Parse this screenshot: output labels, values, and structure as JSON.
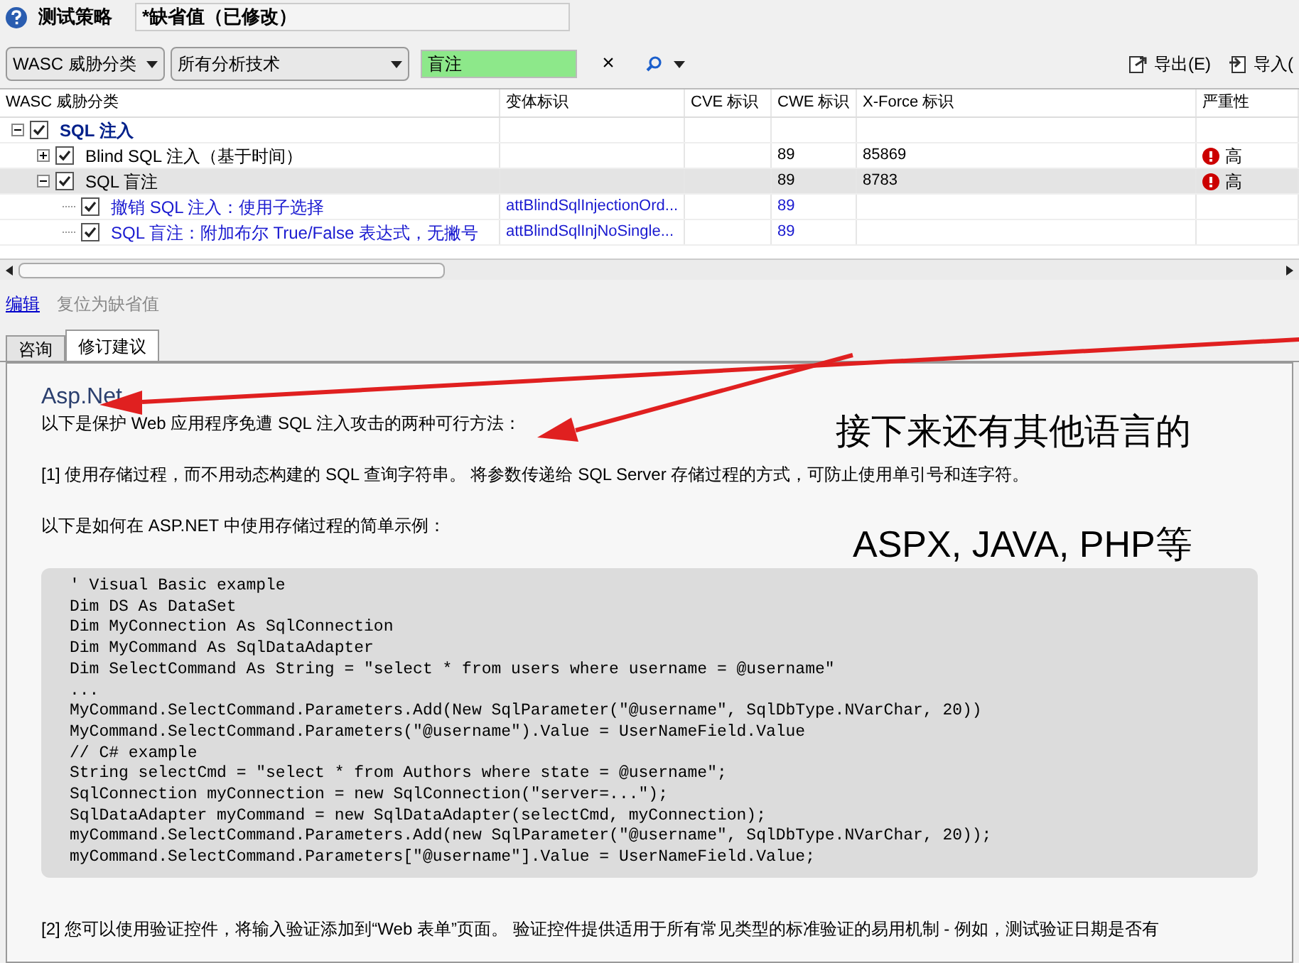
{
  "header": {
    "title": "测试策略",
    "policy": "*缺省值（已修改）"
  },
  "toolbar": {
    "group_select": "WASC 威胁分类",
    "technique_select": "所有分析技术",
    "filter": {
      "value": "盲注",
      "clear": "×"
    },
    "export": "导出(E)",
    "import": "导入("
  },
  "table": {
    "columns": [
      "WASC 威胁分类",
      "变体标识",
      "CVE 标识",
      "CWE 标识",
      "X-Force 标识",
      "严重性"
    ],
    "rows": [
      {
        "kind": "category",
        "label": "SQL 注入",
        "checked": true,
        "expanded": true,
        "selected": false,
        "cells": [
          "",
          "",
          "",
          "",
          ""
        ],
        "children": [
          {
            "kind": "group",
            "label": "Blind SQL 注入（基于时间）",
            "checked": true,
            "expanded": false,
            "selected": false,
            "cells": [
              "",
              "",
              "89",
              "85869",
              "高"
            ]
          },
          {
            "kind": "group",
            "label": "SQL 盲注",
            "checked": true,
            "expanded": true,
            "selected": true,
            "cells": [
              "",
              "",
              "89",
              "8783",
              "高"
            ],
            "children": [
              {
                "kind": "variant",
                "label": "撤销 SQL 注入：使用子选择",
                "checked": true,
                "selected": false,
                "cells": [
                  "attBlindSqlInjectionOrd...",
                  "",
                  "89",
                  "",
                  ""
                ]
              },
              {
                "kind": "variant",
                "label": "SQL 盲注：附加布尔 True/False 表达式，无撇号",
                "checked": true,
                "selected": false,
                "cells": [
                  "attBlindSqlInjNoSingle...",
                  "",
                  "89",
                  "",
                  ""
                ]
              }
            ]
          }
        ]
      }
    ]
  },
  "links": {
    "edit": "编辑",
    "reset": "复位为缺省值"
  },
  "tabs": [
    {
      "label": "咨询",
      "selected": false
    },
    {
      "label": "修订建议",
      "selected": true
    }
  ],
  "advice": {
    "heading": "Asp.Net",
    "paragraphs": [
      "以下是保护 Web 应用程序免遭 SQL 注入攻击的两种可行方法：",
      "[1] 使用存储过程，而不用动态构建的 SQL 查询字符串。 将参数传递给 SQL Server 存储过程的方式，可防止使用单引号和连字符。",
      "以下是如何在 ASP.NET 中使用存储过程的简单示例："
    ],
    "code": [
      "' Visual Basic example",
      "Dim DS As DataSet",
      "Dim MyConnection As SqlConnection",
      "Dim MyCommand As SqlDataAdapter",
      "Dim SelectCommand As String = \"select * from users where username = @username\"",
      "...",
      "MyCommand.SelectCommand.Parameters.Add(New SqlParameter(\"@username\", SqlDbType.NVarChar, 20))",
      "MyCommand.SelectCommand.Parameters(\"@username\").Value = UserNameField.Value",
      "// C# example",
      "String selectCmd = \"select * from Authors where state = @username\";",
      "SqlConnection myConnection = new SqlConnection(\"server=...\");",
      "SqlDataAdapter myCommand = new SqlDataAdapter(selectCmd, myConnection);",
      "myCommand.SelectCommand.Parameters.Add(new SqlParameter(\"@username\", SqlDbType.NVarChar, 20));",
      "myCommand.SelectCommand.Parameters[\"@username\"].Value = UserNameField.Value;"
    ],
    "after": "[2] 您可以使用验证控件，将输入验证添加到“Web 表单”页面。 验证控件提供适用于所有常见类型的标准验证的易用机制 - 例如，测试验证日期是否有"
  },
  "annotations": [
    "接下来还有其他语言的",
    "ASPX, JAVA, PHP等"
  ]
}
